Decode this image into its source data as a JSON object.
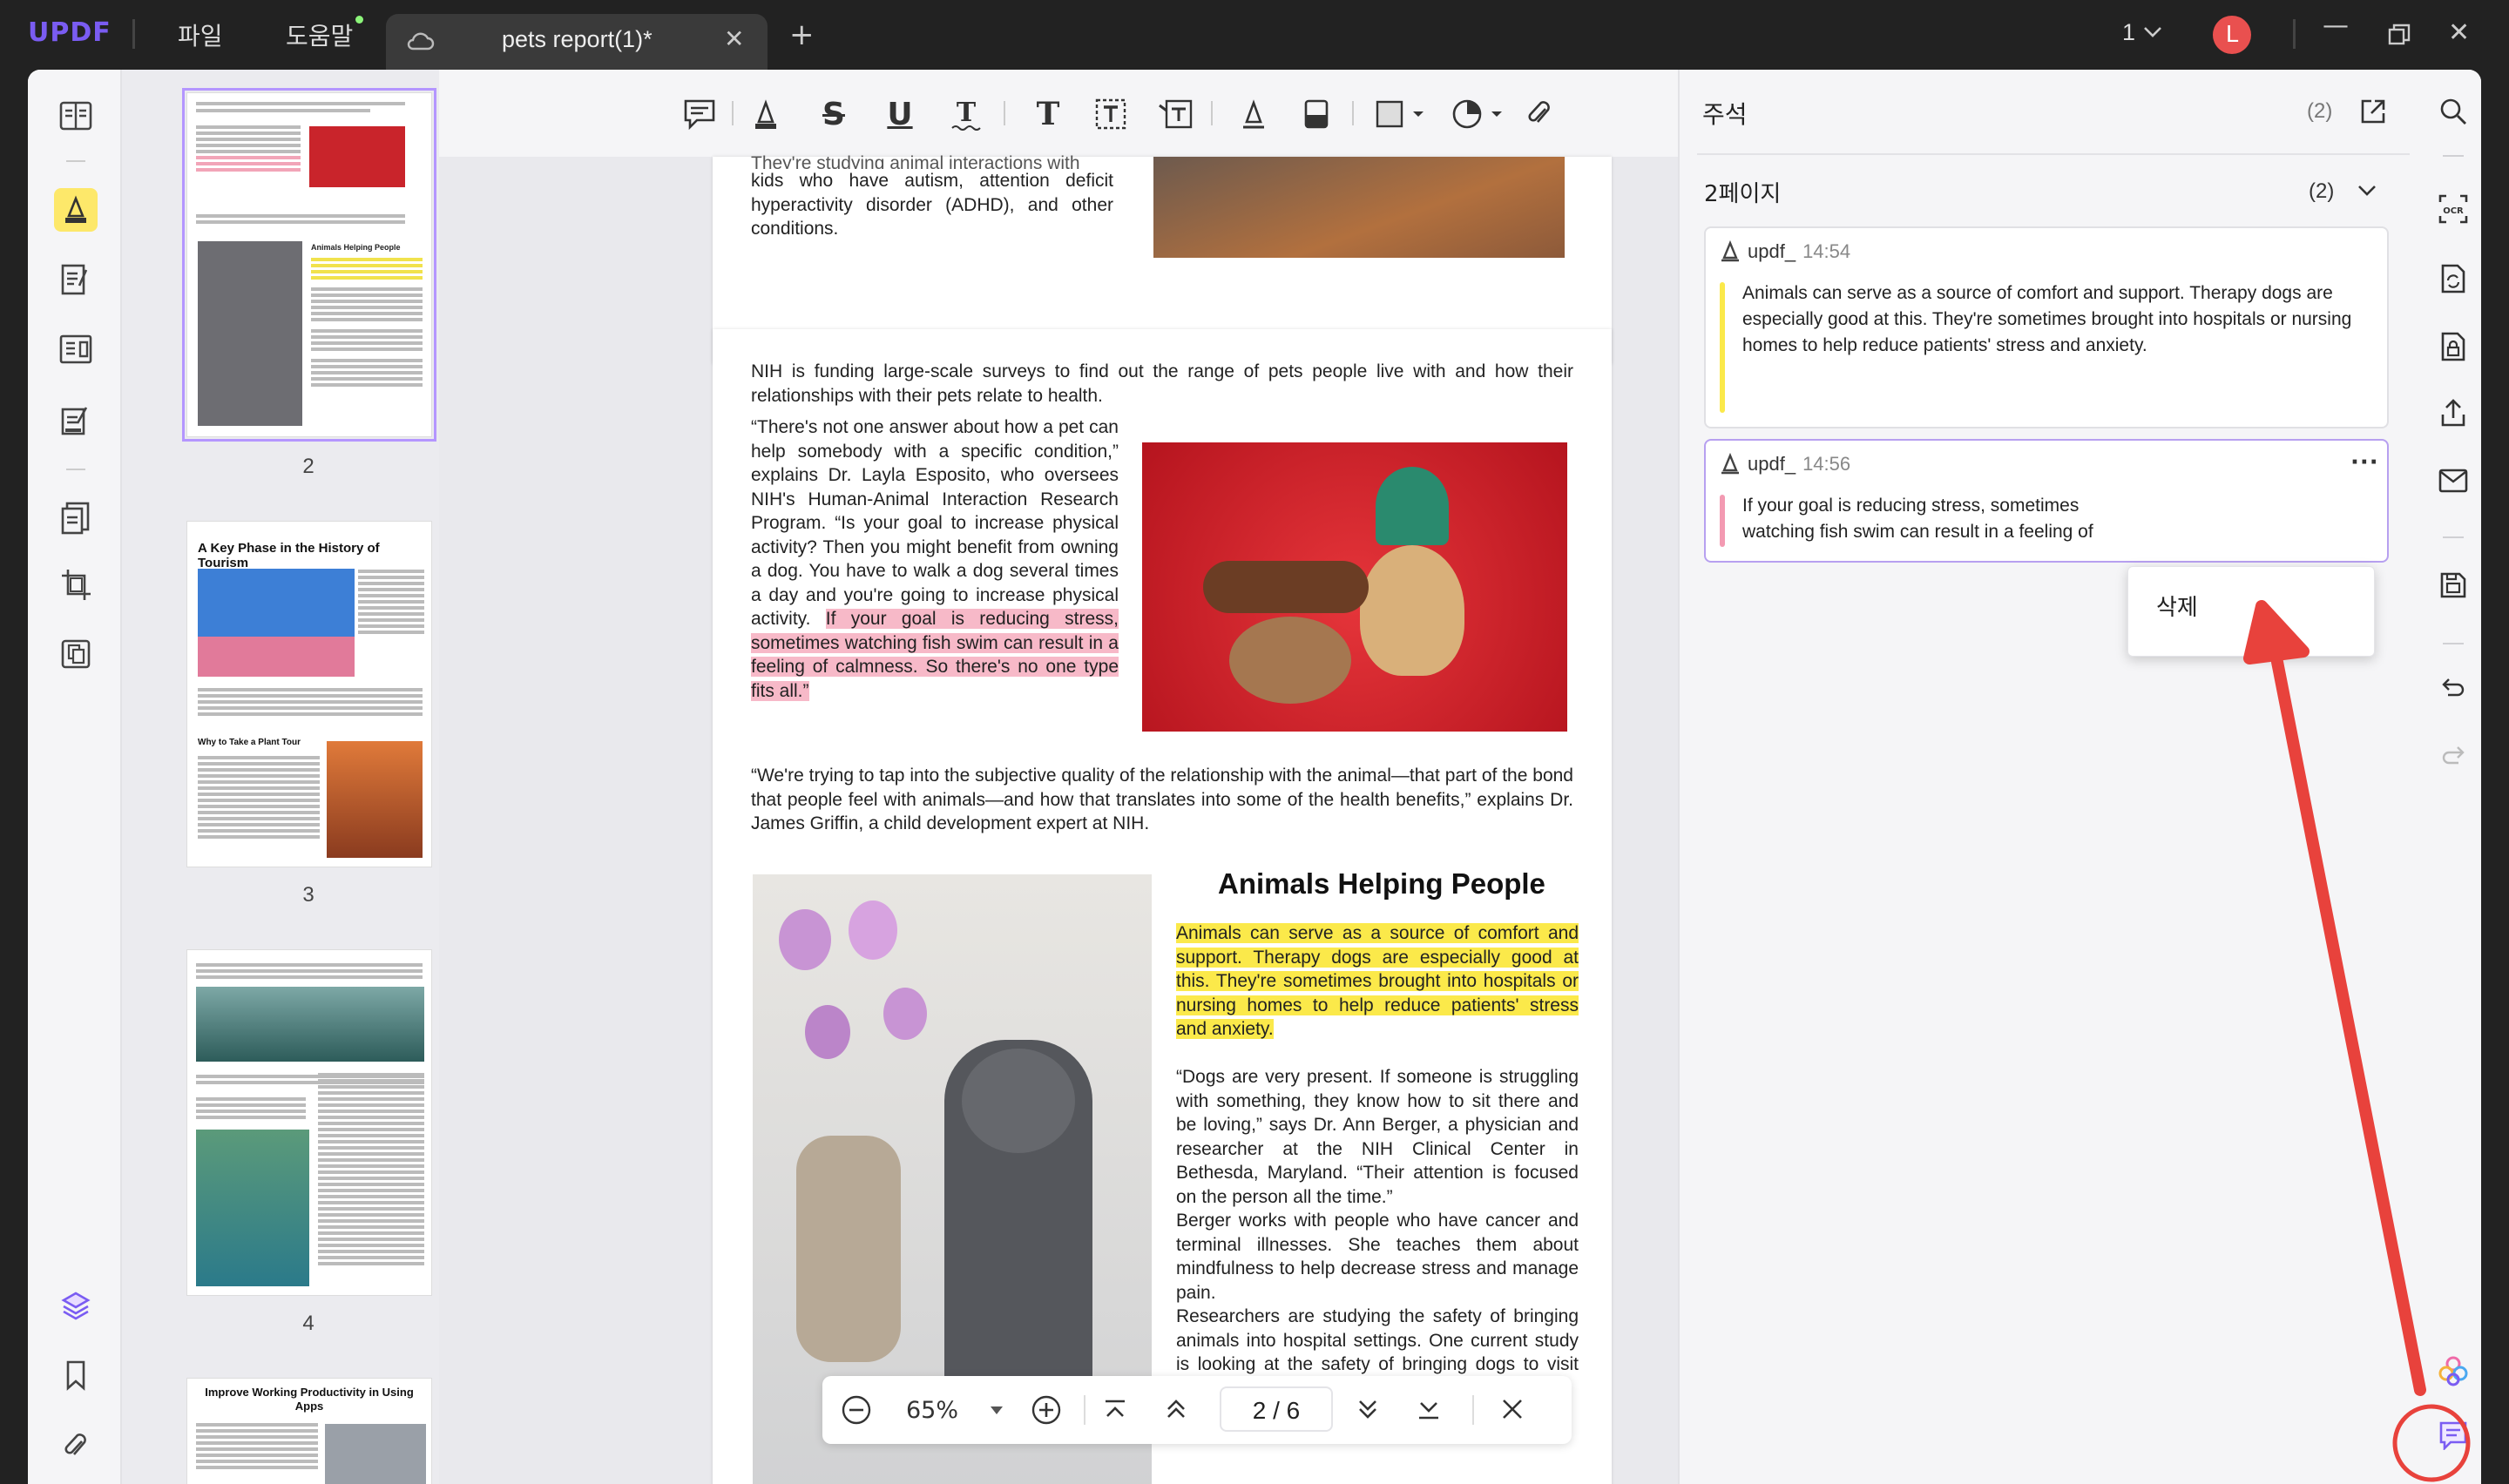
{
  "app": {
    "logo": "UPDF",
    "menu_file": "파일",
    "menu_help": "도움말",
    "tab_title": "pets report(1)*",
    "window_count": "1",
    "avatar": "L"
  },
  "thumbs": {
    "pages": [
      "2",
      "3",
      "4"
    ],
    "p3_title": "A Key Phase in the History of Tourism",
    "p3_sub": "Why to Take a Plant Tour",
    "p2_title": "Animals Helping People",
    "p5_title": "Improve Working Productivity in Using Apps"
  },
  "doc": {
    "top_text": "kids who have autism, attention deficit hyperactivity disorder (ADHD), and other conditions.",
    "top_partial": "They're studying animal interactions with",
    "para1": "NIH is funding large-scale surveys to find out the range of pets people live with and how their relationships with their pets relate to health.",
    "para2a": "“There's not one answer about how a pet can help somebody with a specific condition,” explains Dr. Layla Esposito, who oversees NIH's Human-Animal Interaction Research Program. “Is your goal to increase physical activity? Then you might benefit from owning a dog. You have to walk a dog several times a day and you're going to increase physical activity.",
    "para2b": "If your goal is reducing stress, sometimes watching fish swim can result in a feeling of calmness. So there's no one type fits all.”",
    "para3": "“We're trying to tap into the subjective quality of the relationship with the animal—that part of the bond that people feel with animals—and how that translates into some of the health benefits,” explains Dr. James Griffin, a child development expert at NIH.",
    "heading": "Animals Helping People",
    "para4": "Animals can serve as a source of comfort and support. Therapy dogs are especially good at this. They're sometimes brought into hospitals or nursing homes to help reduce patients' stress and anxiety.",
    "para5": "“Dogs are very present. If someone is struggling with something, they know how to sit there and be loving,” says Dr. Ann Berger, a physician and researcher at the NIH Clinical Center in Bethesda, Maryland. “Their attention is focused on the person all the time.”",
    "para6": "Berger works with people who have cancer and terminal illnesses. She teaches them about mindfulness to help decrease stress and manage pain.",
    "para7": "Researchers are studying the safety of bringing animals into hospital settings. One current study is looking at the safety of bringing dogs to visit children with cancer, Esposito says."
  },
  "zoom": {
    "level": "65%",
    "page": "2 / 6"
  },
  "notes": {
    "title": "주석",
    "count": "(2)",
    "page_label": "2페이지",
    "page_count": "(2)",
    "items": [
      {
        "user": "updf_",
        "time": "14:54",
        "text": "Animals can serve as a source of comfort and support. Therapy dogs are especially good at this. They're sometimes brought into hospitals or nursing homes to help reduce patients' stress and anxiety.",
        "color": "#fbe94a"
      },
      {
        "user": "updf_",
        "time": "14:56",
        "text": "If your goal is reducing stress, sometimes watching fish swim can result in a feeling of calmness. So there's no one type fits all.",
        "color": "#f39ab2"
      }
    ],
    "menu_delete": "삭제"
  },
  "colors": {
    "accent": "#7a5cf2",
    "highlight_yellow": "#fbe94a",
    "highlight_pink": "#f7b9c8",
    "arrow": "#e8423c"
  }
}
